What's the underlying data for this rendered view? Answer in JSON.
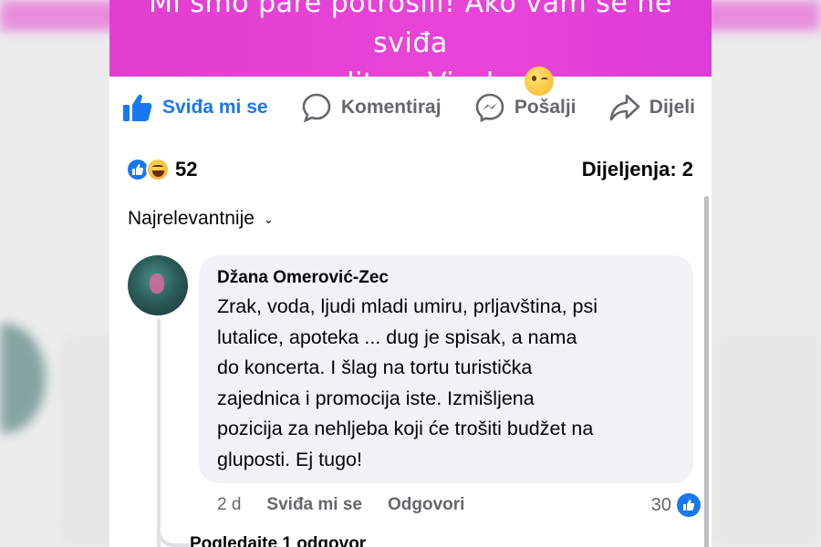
{
  "post": {
    "banner_line1": "Mi smo pare potrošili! Ako vam se ne sviđa",
    "banner_line2": "razgulite u Visoko",
    "banner_emoji": "winking-face-emoji"
  },
  "actions": {
    "like_label": "Sviđa mi se",
    "comment_label": "Komentiraj",
    "send_label": "Pošalji",
    "share_label": "Dijeli",
    "like_color": "#1877f2",
    "inactive_color": "#65676b"
  },
  "stats": {
    "reaction_count": "52",
    "reaction_icons": [
      "like-reaction-icon",
      "haha-reaction-icon"
    ],
    "shares_label": "Dijeljenja: 2"
  },
  "sort": {
    "label": "Najrelevantnije"
  },
  "comment": {
    "author": "Džana Omerović-Zec",
    "text": "Zrak, voda, ljudi mladi umiru, prljavština, psi\nlutalice, apoteka ... dug je spisak, a nama\ndo koncerta. I šlag na tortu turistička\nzajednica i promocija iste. Izmišljena\npozicija za nehljeba koji će trošiti budžet na\ngluposti. Ej tugo!",
    "time": "2 d",
    "like_label": "Sviđa mi se",
    "reply_label": "Odgovori",
    "like_count": "30",
    "view_replies": "Pogledajte 1 odgovor"
  }
}
